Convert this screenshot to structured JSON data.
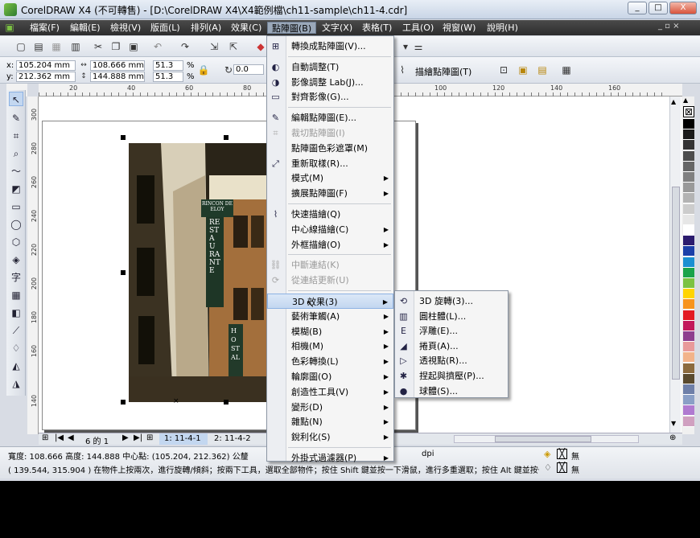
{
  "window": {
    "title": "CorelDRAW X4 (不可轉售) - [D:\\CorelDRAW X4\\X4範例檔\\ch11-sample\\ch11-4.cdr]",
    "buttons": [
      "_",
      "□",
      "X"
    ]
  },
  "menubar": {
    "items": [
      "檔案(F)",
      "編輯(E)",
      "檢視(V)",
      "版面(L)",
      "排列(A)",
      "效果(C)",
      "點陣圖(B)",
      "文字(X)",
      "表格(T)",
      "工具(O)",
      "視窗(W)",
      "說明(H)"
    ],
    "active_index": 6
  },
  "property_bar": {
    "x": "105.204 mm",
    "y": "212.362 mm",
    "width": "108.666 mm",
    "height": "144.888 mm",
    "scale_x": "51.3",
    "scale_y": "51.3",
    "percent": "%",
    "rotation": "0.0",
    "trace_button": "描繪點陣圖(T)"
  },
  "rulers": {
    "horizontal": [
      "20",
      "40",
      "60",
      "80",
      "100",
      "120",
      "140",
      "160"
    ],
    "vertical": [
      "300",
      "280",
      "260",
      "240",
      "220",
      "200",
      "180",
      "160",
      "140"
    ]
  },
  "photo_signs": {
    "rincon": "RINCON DE ELOY",
    "restaurant": "RESTAURANTE",
    "hostal": "HOSTAL"
  },
  "bitmap_menu": {
    "items": [
      {
        "label": "轉換成點陣圖(V)...",
        "icon": "convert-bitmap-icon",
        "disabled": false
      },
      {
        "sep": true
      },
      {
        "label": "自動調整(T)",
        "icon": "auto-adjust-icon",
        "disabled": false
      },
      {
        "label": "影像調整 Lab(J)...",
        "icon": "image-adjust-lab-icon",
        "disabled": false
      },
      {
        "label": "對齊影像(G)...",
        "icon": "straighten-image-icon",
        "disabled": false
      },
      {
        "sep": true
      },
      {
        "label": "編輯點陣圖(E)...",
        "icon": "edit-bitmap-icon",
        "disabled": false
      },
      {
        "label": "裁切點陣圖(I)",
        "icon": "crop-bitmap-icon",
        "disabled": true
      },
      {
        "label": "點陣圖色彩遮罩(M)",
        "icon": "",
        "disabled": false
      },
      {
        "label": "重新取樣(R)...",
        "icon": "resample-icon",
        "disabled": false
      },
      {
        "label": "模式(M)",
        "icon": "",
        "disabled": false,
        "submenu": true
      },
      {
        "label": "擴展點陣圖(F)",
        "icon": "",
        "disabled": false,
        "submenu": true
      },
      {
        "sep": true
      },
      {
        "label": "快速描繪(Q)",
        "icon": "quick-trace-icon",
        "disabled": false
      },
      {
        "label": "中心線描繪(C)",
        "icon": "",
        "disabled": false,
        "submenu": true
      },
      {
        "label": "外框描繪(O)",
        "icon": "",
        "disabled": false,
        "submenu": true
      },
      {
        "sep": true
      },
      {
        "label": "中斷連結(K)",
        "icon": "break-link-icon",
        "disabled": true
      },
      {
        "label": "從連結更新(U)",
        "icon": "update-link-icon",
        "disabled": true
      },
      {
        "sep": true
      },
      {
        "label": "3D 效果(3)",
        "icon": "",
        "disabled": false,
        "submenu": true,
        "highlighted": true
      },
      {
        "label": "藝術筆觸(A)",
        "icon": "",
        "disabled": false,
        "submenu": true
      },
      {
        "label": "模糊(B)",
        "icon": "",
        "disabled": false,
        "submenu": true
      },
      {
        "label": "相機(M)",
        "icon": "",
        "disabled": false,
        "submenu": true
      },
      {
        "label": "色彩轉換(L)",
        "icon": "",
        "disabled": false,
        "submenu": true
      },
      {
        "label": "輪廓圖(O)",
        "icon": "",
        "disabled": false,
        "submenu": true
      },
      {
        "label": "創造性工具(V)",
        "icon": "",
        "disabled": false,
        "submenu": true
      },
      {
        "label": "變形(D)",
        "icon": "",
        "disabled": false,
        "submenu": true
      },
      {
        "label": "雜點(N)",
        "icon": "",
        "disabled": false,
        "submenu": true
      },
      {
        "label": "銳利化(S)",
        "icon": "",
        "disabled": false,
        "submenu": true
      },
      {
        "sep": true
      },
      {
        "label": "外掛式過濾器(P)",
        "icon": "",
        "disabled": false,
        "submenu": true
      }
    ]
  },
  "submenu_3d": {
    "items": [
      {
        "label": "3D 旋轉(3)...",
        "icon": "3d-rotate-icon"
      },
      {
        "label": "圓柱體(L)...",
        "icon": "cylinder-icon"
      },
      {
        "label": "浮雕(E)...",
        "icon": "emboss-icon"
      },
      {
        "label": "捲頁(A)...",
        "icon": "page-curl-icon"
      },
      {
        "label": "透視點(R)...",
        "icon": "perspective-icon"
      },
      {
        "label": "捏起與擠壓(P)...",
        "icon": "pinch-punch-icon"
      },
      {
        "label": "球體(S)...",
        "icon": "sphere-icon"
      }
    ]
  },
  "page_bar": {
    "counter": "6 的 1",
    "tabs": [
      "1: 11-4-1",
      "2: 11-4-2"
    ]
  },
  "status": {
    "line1": "寬度: 108.666  高度: 144.888  中心點: (105.204, 212.362)  公釐",
    "dpi": "dpi",
    "line2": "( 139.544, 315.904 )    在物件上按兩次，進行旋轉/傾斜；按兩下工具，選取全部物件；按住 Shift 鍵並按一下滑鼠，進行多重選取；按住 Alt 鍵並按一...",
    "fill_label": "無",
    "outline_label": "無"
  },
  "palette_colors": [
    "#000000",
    "#1a1a1a",
    "#333333",
    "#4d4d4d",
    "#666666",
    "#808080",
    "#999999",
    "#b3b3b3",
    "#cccccc",
    "#e6e6e6",
    "#ffffff",
    "#2b1b6e",
    "#1b3fa8",
    "#1a8fd1",
    "#1aa34a",
    "#7cc242",
    "#ffd400",
    "#f7941d",
    "#e31b23",
    "#c2185b",
    "#8e3f8e",
    "#e89a9a",
    "#f2b38a",
    "#8c6b3e",
    "#5a4a2e",
    "#6e7fa8",
    "#8a9fc6",
    "#b07ad0",
    "#d0a0c0"
  ],
  "colors": {
    "menubar": "#2d2d2d",
    "highlight": "#c3d7f0",
    "title": "#c9d5e6"
  }
}
